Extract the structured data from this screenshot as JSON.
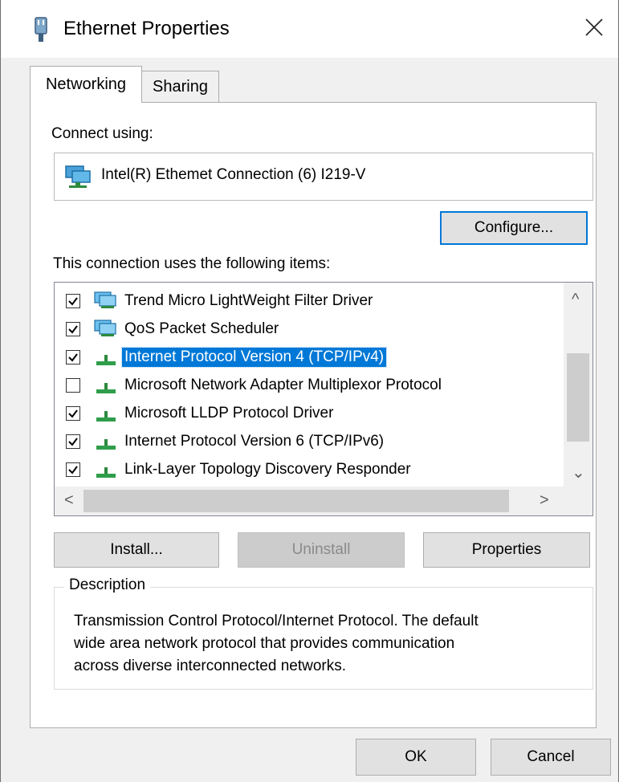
{
  "window": {
    "title": "Ethernet Properties",
    "title_icon": "network-adapter-icon",
    "close_icon": "close-icon"
  },
  "tabs": [
    {
      "label": "Networking",
      "active": true
    },
    {
      "label": "Sharing",
      "active": false
    }
  ],
  "connect_using": {
    "label": "Connect using:",
    "adapter_name": "Intel(R) Ethemet Connection (6) I219-V",
    "adapter_icon": "network-adapter-icon",
    "configure_label": "Configure..."
  },
  "items_section": {
    "label": "This connection uses the following items:",
    "items": [
      {
        "label": "Trend Micro LightWeight Filter Driver",
        "checked": true,
        "icon": "network-service-icon",
        "selected": false
      },
      {
        "label": "QoS Packet Scheduler",
        "checked": true,
        "icon": "network-service-icon",
        "selected": false
      },
      {
        "label": "Internet Protocol Version 4 (TCP/IPv4)",
        "checked": true,
        "icon": "protocol-icon",
        "selected": true
      },
      {
        "label": "Microsoft Network Adapter Multiplexor Protocol",
        "checked": false,
        "icon": "protocol-icon",
        "selected": false
      },
      {
        "label": "Microsoft LLDP Protocol Driver",
        "checked": true,
        "icon": "protocol-icon",
        "selected": false
      },
      {
        "label": "Internet Protocol Version 6 (TCP/IPv6)",
        "checked": true,
        "icon": "protocol-icon",
        "selected": false
      },
      {
        "label": "Link-Layer Topology Discovery Responder",
        "checked": true,
        "icon": "protocol-icon",
        "selected": false
      }
    ]
  },
  "buttons": {
    "install": "Install...",
    "uninstall": "Uninstall",
    "properties": "Properties",
    "ok": "OK",
    "cancel": "Cancel"
  },
  "description": {
    "legend": "Description",
    "line1": "Transmission Control Protocol/Internet Protocol. The default",
    "line2": "wide area network protocol that provides communication",
    "line3": "across diverse interconnected networks."
  },
  "colors": {
    "accent": "#0078d7",
    "selection": "#0078d7",
    "dialog_bg": "#f0f0f0"
  }
}
